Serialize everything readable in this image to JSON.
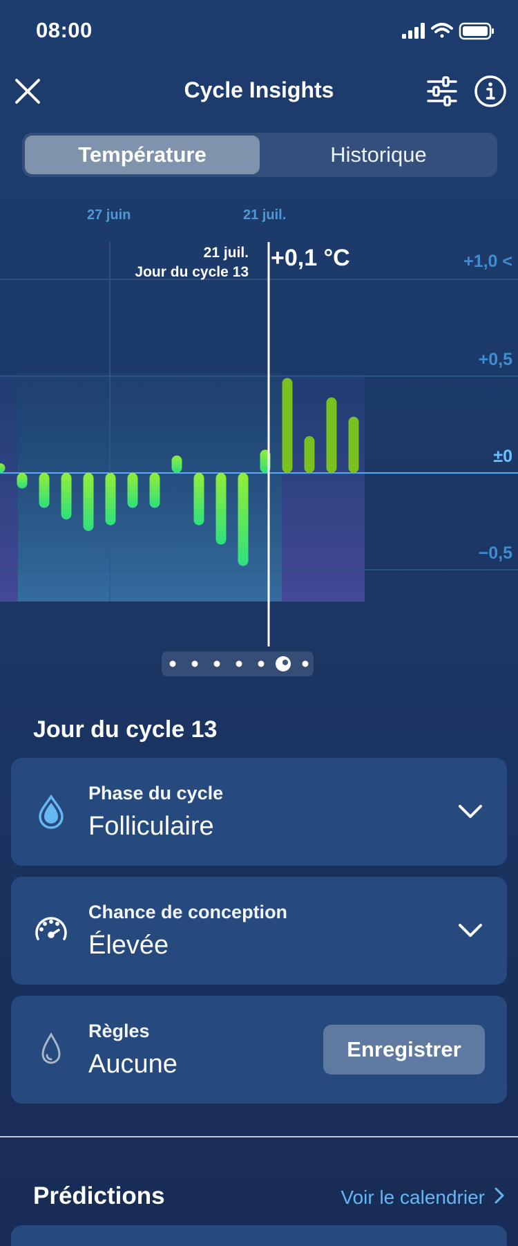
{
  "status_bar": {
    "time": "08:00"
  },
  "header": {
    "title": "Cycle Insights"
  },
  "tabs": [
    {
      "label": "Température",
      "selected": true
    },
    {
      "label": "Historique",
      "selected": false
    }
  ],
  "chart": {
    "date_labels": [
      "27 juin",
      "21 juil."
    ],
    "tooltip_date": "21 juil.",
    "tooltip_day": "Jour du cycle 13",
    "tooltip_value": "+0,1 °C",
    "y_ticks": [
      "+1,0 <",
      "+0,5",
      "±0",
      "−0,5"
    ],
    "pager_pages": 7,
    "pager_active_index": 5
  },
  "chart_data": {
    "type": "bar",
    "unit": "°C",
    "ylim": [
      -0.9,
      1.15
    ],
    "y_ticks": [
      1.0,
      0.5,
      0.0,
      -0.5
    ],
    "values": [
      0.05,
      -0.08,
      -0.18,
      -0.24,
      -0.3,
      -0.27,
      -0.18,
      -0.18,
      0.09,
      -0.27,
      -0.37,
      -0.48,
      0.12,
      0.49,
      0.19,
      0.39,
      0.29
    ],
    "selected_index": 12,
    "selected_value": 0.1
  },
  "day_section": {
    "title": "Jour du cycle 13"
  },
  "cards": {
    "phase": {
      "label": "Phase du cycle",
      "value": "Folliculaire",
      "icon": "drop-filled-icon"
    },
    "chance": {
      "label": "Chance de conception",
      "value": "Élevée",
      "icon": "gauge-icon"
    },
    "rules": {
      "label": "Règles",
      "value": "Aucune",
      "icon": "drop-outline-icon",
      "button": "Enregistrer"
    }
  },
  "predictions": {
    "title": "Prédictions",
    "link": "Voir le calendrier"
  },
  "colors": {
    "accent": "#67b6f4",
    "bar_green_top": "#93ee37",
    "bar_green_bottom": "#2de07e",
    "bar_luteal": "#79c11e",
    "card_bg": "#26497e"
  }
}
